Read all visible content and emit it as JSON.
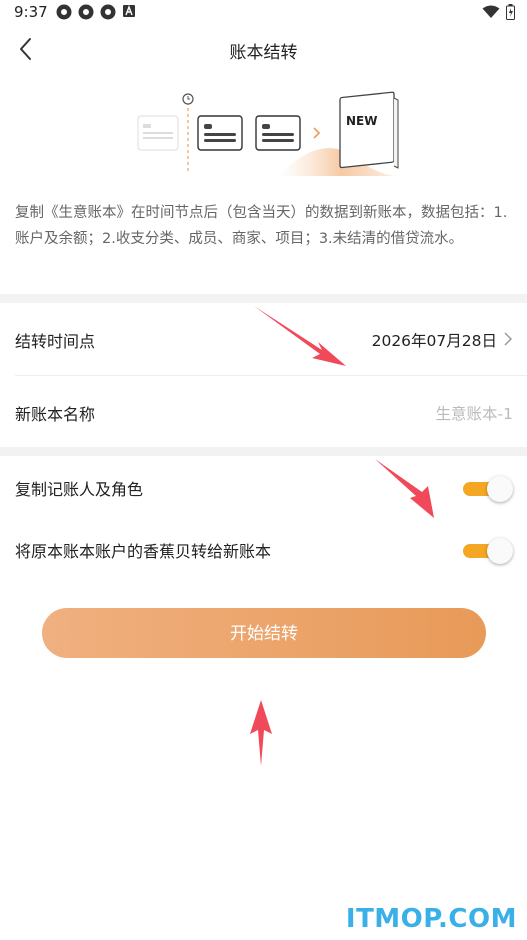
{
  "status_bar": {
    "time": "9:37"
  },
  "nav": {
    "title": "账本结转"
  },
  "illustration": {
    "badge": "NEW"
  },
  "description": "复制《生意账本》在时间节点后（包含当天）的数据到新账本，数据包括：1.账户及余额；2.收支分类、成员、商家、项目；3.未结清的借贷流水。",
  "form": {
    "transfer_date": {
      "label": "结转时间点",
      "value": "2026年07月28日"
    },
    "new_book_name": {
      "label": "新账本名称",
      "placeholder": "生意账本-1"
    }
  },
  "toggles": [
    {
      "label": "复制记账人及角色",
      "on": true
    },
    {
      "label": "将原本账本账户的香蕉贝转给新账本",
      "on": true
    }
  ],
  "start_button": {
    "label": "开始结转"
  },
  "watermark": "ITMOP.COM",
  "colors": {
    "accent": "#f5a623",
    "button": "#eba264",
    "arrow": "#f04a5a",
    "watermark": "#3ab0e8"
  }
}
